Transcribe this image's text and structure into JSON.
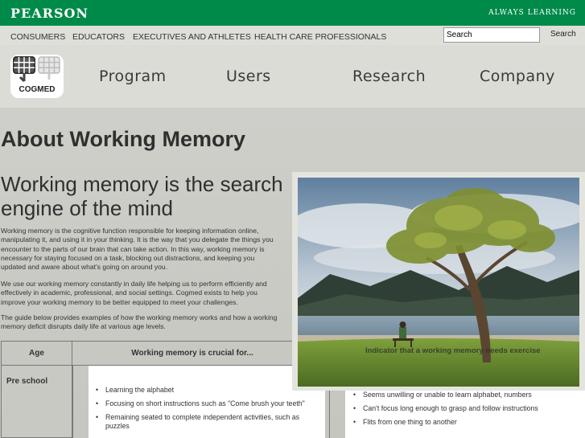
{
  "brand": {
    "name": "PEARSON",
    "tagline": "ALWAYS LEARNING"
  },
  "audience_nav": [
    "CONSUMERS",
    "EDUCATORS",
    "EXECUTIVES AND ATHLETES",
    "HEALTH CARE PROFESSIONALS"
  ],
  "search": {
    "value": "Search",
    "button": "Search"
  },
  "logo": {
    "label": "COGMED"
  },
  "main_nav": [
    "Program",
    "Users",
    "Research",
    "Company"
  ],
  "page_title": "About Working Memory",
  "headline": "Working memory is the search engine of the mind",
  "paragraphs": [
    "Working memory is the cognitive function responsible for keeping information online, manipulating it, and using it in your thinking. It is the way that you delegate the things you encounter to the parts of our brain that can take action. In this way, working memory is necessary for staying focused on a task, blocking out distractions, and keeping you updated and aware about what's going on around you.",
    "We use our working memory constantly in daily life helping us to perform efficiently and effectively in academic, professional, and social settings. Cogmed exists to help you improve your working memory to be better equipped to meet your challenges.",
    "The guide below provides examples of how the working memory works and how a working memory deficit disrupts daily life at various age levels."
  ],
  "table": {
    "headers": [
      "Age",
      "Working memory is crucial for..."
    ],
    "row": {
      "age": "Pre school",
      "crucial_for": [
        "Learning the alphabet",
        "Focusing on short instructions such as \"Come brush your teeth\"",
        "Remaining seated to complete independent activities, such as puzzles"
      ],
      "indicators": [
        "Seems unwilling or unable to learn alphabet, numbers",
        "Can't focus long enough to grasp and follow instructions",
        "Flits from one thing to another"
      ]
    }
  },
  "photo": {
    "caption": "Indicator that a working memory needs exercise"
  },
  "colors": {
    "brand_green": "#008a4a",
    "background": "#c9c9c3",
    "text": "#333333"
  }
}
